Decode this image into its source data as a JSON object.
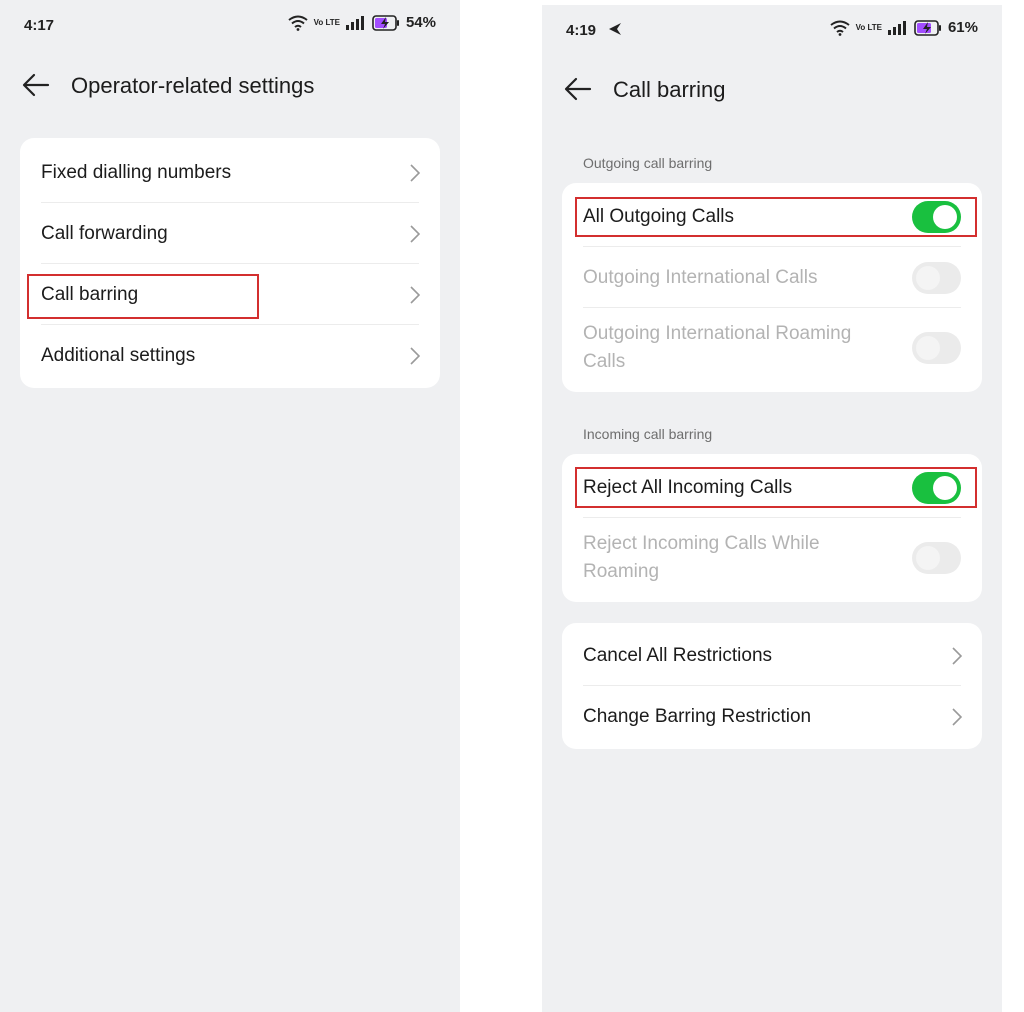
{
  "left_screen": {
    "status_bar": {
      "time": "4:17",
      "network": "Vo LTE",
      "battery_percent": "54%"
    },
    "header": {
      "title": "Operator-related settings"
    },
    "menu": [
      {
        "label": "Fixed dialling numbers"
      },
      {
        "label": "Call forwarding"
      },
      {
        "label": "Call barring",
        "highlighted": true
      },
      {
        "label": "Additional settings"
      }
    ]
  },
  "right_screen": {
    "status_bar": {
      "time": "4:19",
      "network": "Vo LTE",
      "battery_percent": "61%"
    },
    "header": {
      "title": "Call barring"
    },
    "outgoing": {
      "section_label": "Outgoing call barring",
      "items": [
        {
          "label": "All Outgoing Calls",
          "enabled": true,
          "toggle": "on",
          "highlighted": true
        },
        {
          "label": "Outgoing International Calls",
          "enabled": false,
          "toggle": "off"
        },
        {
          "label": "Outgoing International Roaming Calls",
          "enabled": false,
          "toggle": "off"
        }
      ]
    },
    "incoming": {
      "section_label": "Incoming call barring",
      "items": [
        {
          "label": "Reject All Incoming Calls",
          "enabled": true,
          "toggle": "on",
          "highlighted": true
        },
        {
          "label": "Reject Incoming Calls While Roaming",
          "enabled": false,
          "toggle": "off"
        }
      ]
    },
    "actions": [
      {
        "label": "Cancel All Restrictions"
      },
      {
        "label": "Change Barring Restriction"
      }
    ]
  },
  "colors": {
    "background": "#eff0f2",
    "card": "#ffffff",
    "toggle_on": "#19c03f",
    "toggle_off": "#ebebeb",
    "highlight": "#d32f2f",
    "battery_accent": "#a24dff"
  },
  "icons": [
    "back-arrow-icon",
    "chevron-right-icon",
    "wifi-icon",
    "signal-icon",
    "battery-charging-icon",
    "navigation-arrow-icon"
  ]
}
